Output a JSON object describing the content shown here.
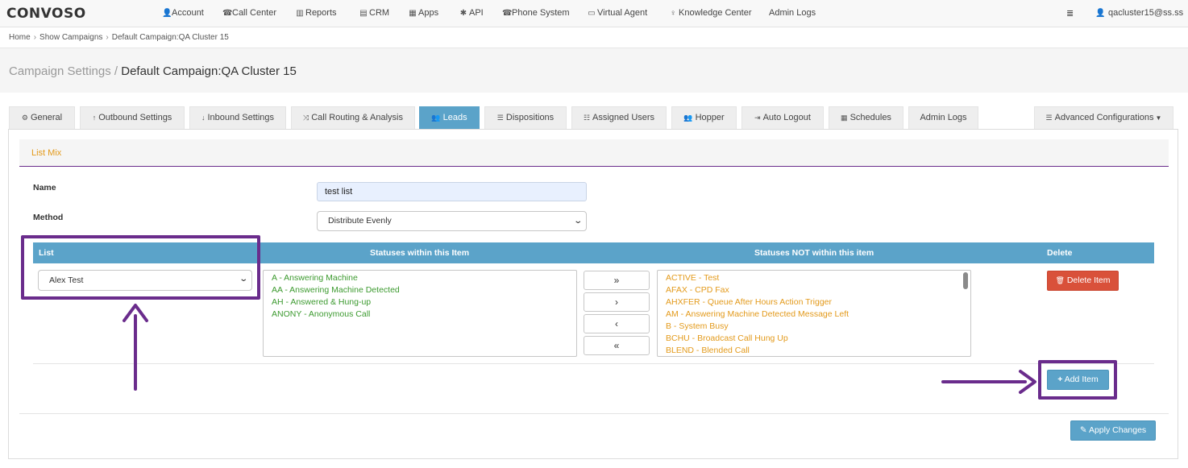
{
  "brand": {
    "logo": "CONVOSO"
  },
  "nav": {
    "items": [
      {
        "label": "Account",
        "icon": "user-icon",
        "glyph": "👤"
      },
      {
        "label": "Call Center",
        "icon": "phone-icon",
        "glyph": "☎"
      },
      {
        "label": "Reports",
        "icon": "bar-chart-icon",
        "glyph": "▥"
      },
      {
        "label": "CRM",
        "icon": "table-icon",
        "glyph": "▤"
      },
      {
        "label": "Apps",
        "icon": "grid-icon",
        "glyph": "▦"
      },
      {
        "label": "API",
        "icon": "gear-icon",
        "glyph": "✱"
      },
      {
        "label": "Phone System",
        "icon": "phone-icon",
        "glyph": "☎"
      },
      {
        "label": "Virtual Agent",
        "icon": "monitor-icon",
        "glyph": "▭"
      },
      {
        "label": "Knowledge Center",
        "icon": "lightbulb-icon",
        "glyph": "♀"
      },
      {
        "label": "Admin Logs",
        "icon": "",
        "glyph": ""
      }
    ],
    "user": "qacluster15@ss.ss"
  },
  "breadcrumb": [
    "Home",
    "Show Campaigns",
    "Default Campaign:QA Cluster 15"
  ],
  "page": {
    "title_prefix": "Campaign Settings /",
    "title": "Default Campaign:QA Cluster 15"
  },
  "tabs": [
    {
      "label": "General",
      "icon": "gears-icon",
      "glyph": "⚙"
    },
    {
      "label": "Outbound Settings",
      "icon": "arrow-up-icon",
      "glyph": "↑"
    },
    {
      "label": "Inbound Settings",
      "icon": "arrow-down-icon",
      "glyph": "↓"
    },
    {
      "label": "Call Routing & Analysis",
      "icon": "random-icon",
      "glyph": "⤨"
    },
    {
      "label": "Leads",
      "icon": "users-icon",
      "glyph": "👥",
      "active": true
    },
    {
      "label": "Dispositions",
      "icon": "list-icon",
      "glyph": "☰"
    },
    {
      "label": "Assigned Users",
      "icon": "list-ol-icon",
      "glyph": "☷"
    },
    {
      "label": "Hopper",
      "icon": "users-icon",
      "glyph": "👥"
    },
    {
      "label": "Auto Logout",
      "icon": "sign-out-icon",
      "glyph": "⇥"
    },
    {
      "label": "Schedules",
      "icon": "calendar-icon",
      "glyph": "▦"
    },
    {
      "label": "Admin Logs",
      "icon": "",
      "glyph": ""
    },
    {
      "label": "Advanced Configurations",
      "icon": "list-icon",
      "glyph": "☰"
    }
  ],
  "section": {
    "title": "List Mix"
  },
  "form": {
    "name_label": "Name",
    "name_value": "test list",
    "method_label": "Method",
    "method_value": "Distribute Evenly"
  },
  "table": {
    "headers": {
      "list": "List",
      "within": "Statuses within this Item",
      "not_within": "Statuses NOT within this item",
      "delete": "Delete"
    },
    "list_value": "Alex Test",
    "within": [
      "A - Answering Machine",
      "AA - Answering Machine Detected",
      "AH - Answered & Hung-up",
      "ANONY - Anonymous Call"
    ],
    "not_within": [
      "ACTIVE - Test",
      "AFAX - CPD Fax",
      "AHXFER - Queue After Hours Action Trigger",
      "AM - Answering Machine Detected Message Left",
      "B - System Busy",
      "BCHU - Broadcast Call Hung Up",
      "BLEND - Blended Call"
    ],
    "move_buttons": [
      "»",
      "›",
      "‹",
      "«"
    ],
    "delete_label": "Delete Item"
  },
  "actions": {
    "add_item": "Add Item",
    "apply_changes": "Apply Changes"
  },
  "colors": {
    "accent": "#5ba3c9",
    "annotation": "#6a2c8c",
    "danger": "#d9513a",
    "warning_text": "#e39a1b",
    "success_text": "#3c9a2f"
  }
}
